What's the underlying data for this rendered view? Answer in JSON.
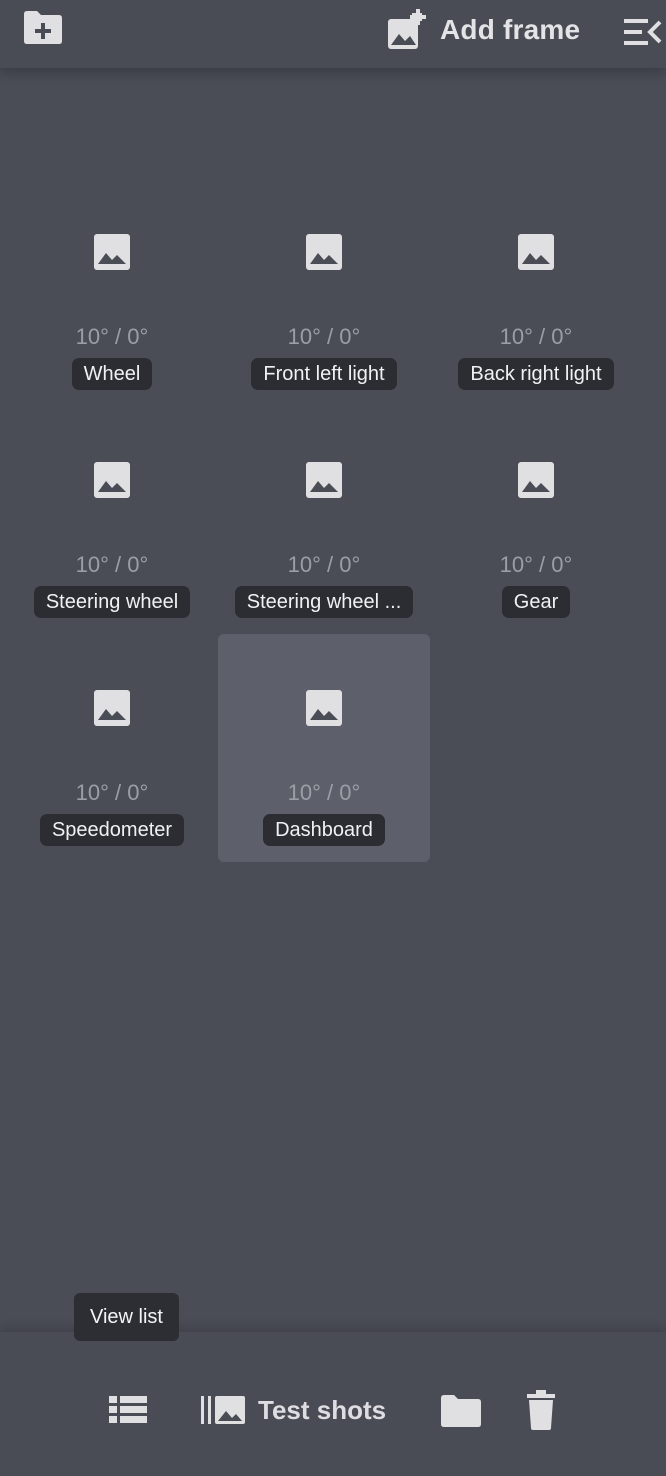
{
  "header": {
    "new_folder_icon": "folder-plus-icon",
    "add_frame_icon": "image-plus-icon",
    "add_frame_label": "Add frame",
    "collapse_icon": "menu-collapse-icon"
  },
  "frames": [
    {
      "angle": "10° / 0°",
      "label": "Wheel",
      "selected": false
    },
    {
      "angle": "10° / 0°",
      "label": "Front left light",
      "selected": false
    },
    {
      "angle": "10° / 0°",
      "label": "Back right light",
      "selected": false
    },
    {
      "angle": "10° / 0°",
      "label": "Steering wheel",
      "selected": false
    },
    {
      "angle": "10° / 0°",
      "label": "Steering wheel ...",
      "selected": false
    },
    {
      "angle": "10° / 0°",
      "label": "Gear",
      "selected": false
    },
    {
      "angle": "10° / 0°",
      "label": "Speedometer",
      "selected": false
    },
    {
      "angle": "10° / 0°",
      "label": "Dashboard",
      "selected": true
    }
  ],
  "toolbar": {
    "tooltip": "View list",
    "view_list_icon": "list-icon",
    "test_shots_icon": "image-gallery-icon",
    "test_shots_label": "Test shots",
    "folder_icon": "folder-icon",
    "trash_icon": "trash-icon"
  },
  "colors": {
    "background": "#4a4c56",
    "selected_tile": "#5d5f6b",
    "label_bg": "#2b2d33",
    "icon": "#e0e0e3",
    "angle_text": "#9c9ea6"
  }
}
